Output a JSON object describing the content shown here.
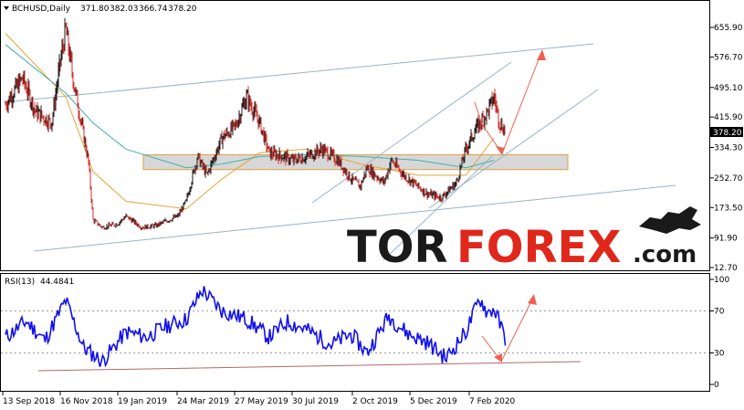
{
  "header": {
    "symbol": "BCHUSD,Daily",
    "open": "371.80",
    "high": "382.03",
    "low": "366.74",
    "close": "378.20"
  },
  "logo": {
    "part1": "TOR",
    "part2": "FOREX",
    "part3": ".com"
  },
  "colors": {
    "candle_up": "#1e1e1e",
    "candle_down": "#d0312d",
    "ma_fast": "#e8a33a",
    "ma_slow": "#3fb0b0",
    "channel": "#9ab3c8",
    "zone": "#c9c9c9",
    "zone_border": "#e0a040",
    "arrow": "#f06050",
    "rsi_line": "#1010ee",
    "rsi_support": "#b06a6a",
    "logo_dark": "#1a1a1a",
    "logo_red": "#e0271b"
  },
  "chart_data": [
    {
      "type": "candlestick",
      "symbol": "BCHUSD",
      "timeframe": "Daily",
      "y_ticks": [
        "655.90",
        "576.70",
        "495.10",
        "415.90",
        "334.30",
        "252.70",
        "173.50",
        "91.90",
        "12.70"
      ],
      "current_price_label": "378.20",
      "x_ticks": [
        "13 Sep 2018",
        "16 Nov 2018",
        "19 Jan 2019",
        "24 Mar 2019",
        "27 May 2019",
        "30 Jul 2019",
        "2 Oct 2019",
        "5 Dec 2019",
        "7 Feb 2020"
      ],
      "ylim": [
        12.7,
        700
      ],
      "series": [
        {
          "kind": "price",
          "x": [
            "2018-09-13",
            "2018-10-01",
            "2018-10-15",
            "2018-11-01",
            "2018-11-10",
            "2018-11-16",
            "2018-11-25",
            "2018-12-10",
            "2018-12-15",
            "2018-12-25",
            "2019-01-10",
            "2019-01-19",
            "2019-02-05",
            "2019-02-20",
            "2019-03-05",
            "2019-03-15",
            "2019-03-24",
            "2019-04-05",
            "2019-04-15",
            "2019-05-01",
            "2019-05-15",
            "2019-05-27",
            "2019-06-10",
            "2019-06-20",
            "2019-07-05",
            "2019-07-15",
            "2019-07-30",
            "2019-08-15",
            "2019-09-01",
            "2019-09-15",
            "2019-09-25",
            "2019-10-02",
            "2019-10-20",
            "2019-10-28",
            "2019-11-10",
            "2019-11-25",
            "2019-12-05",
            "2019-12-20",
            "2020-01-05",
            "2020-01-15",
            "2020-01-25",
            "2020-02-07",
            "2020-02-14",
            "2020-02-20",
            "2020-02-26"
          ],
          "close": [
            450,
            520,
            430,
            400,
            560,
            650,
            500,
            300,
            140,
            120,
            130,
            150,
            120,
            125,
            140,
            150,
            190,
            310,
            260,
            360,
            390,
            470,
            400,
            320,
            310,
            300,
            310,
            330,
            300,
            250,
            230,
            280,
            240,
            300,
            260,
            230,
            210,
            200,
            240,
            330,
            380,
            430,
            470,
            400,
            378
          ]
        }
      ],
      "moving_averages": [
        {
          "label": "fast",
          "x": [
            "2018-09-13",
            "2018-11-16",
            "2018-12-15",
            "2019-01-19",
            "2019-03-24",
            "2019-05-01",
            "2019-06-10",
            "2019-07-30",
            "2019-09-25",
            "2019-11-25",
            "2020-01-15",
            "2020-02-14"
          ],
          "values": [
            640,
            470,
            270,
            190,
            170,
            250,
            320,
            330,
            290,
            260,
            260,
            360
          ]
        },
        {
          "label": "slow",
          "x": [
            "2018-09-13",
            "2018-11-16",
            "2018-12-15",
            "2019-01-19",
            "2019-03-24",
            "2019-05-01",
            "2019-06-10",
            "2019-07-30",
            "2019-09-25",
            "2019-11-25",
            "2020-01-15",
            "2020-02-14"
          ],
          "values": [
            610,
            480,
            400,
            330,
            280,
            290,
            310,
            315,
            310,
            300,
            280,
            300
          ]
        }
      ],
      "support_zone": [
        275,
        315
      ]
    },
    {
      "type": "line",
      "indicator": "RSI(13)",
      "value_label": "44.4841",
      "y_ticks": [
        "100",
        "70",
        "30",
        "0"
      ],
      "ylim": [
        0,
        100
      ],
      "x": [
        "2018-09-13",
        "2018-10-05",
        "2018-10-25",
        "2018-11-16",
        "2018-12-05",
        "2018-12-25",
        "2019-01-19",
        "2019-02-10",
        "2019-03-01",
        "2019-03-24",
        "2019-04-10",
        "2019-05-01",
        "2019-05-27",
        "2019-06-20",
        "2019-07-10",
        "2019-07-30",
        "2019-08-25",
        "2019-09-15",
        "2019-10-02",
        "2019-10-25",
        "2019-11-15",
        "2019-12-05",
        "2019-12-25",
        "2020-01-15",
        "2020-01-30",
        "2020-02-07",
        "2020-02-14",
        "2020-02-26"
      ],
      "values": [
        45,
        60,
        42,
        80,
        35,
        22,
        50,
        45,
        55,
        62,
        90,
        70,
        62,
        45,
        60,
        52,
        38,
        48,
        30,
        65,
        48,
        40,
        25,
        50,
        82,
        68,
        72,
        44
      ]
    }
  ]
}
